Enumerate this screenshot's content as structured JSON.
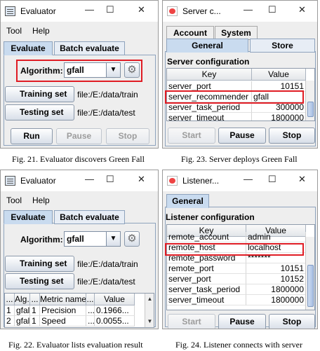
{
  "p21": {
    "title": "Evaluator",
    "menu": [
      "Tool",
      "Help"
    ],
    "tabs": [
      "Evaluate",
      "Batch evaluate"
    ],
    "algorithm_label": "Algorithm:",
    "algorithm_value": "gfall",
    "training_label": "Training set",
    "training_path": "file:/E:/data/train",
    "testing_label": "Testing set",
    "testing_path": "file:/E:/data/test",
    "run": "Run",
    "pause": "Pause",
    "stop": "Stop",
    "caption": "Fig. 21. Evaluator discovers Green Fall"
  },
  "p23": {
    "title": "Server c...",
    "tabs_top": [
      "Account",
      "System"
    ],
    "tabs_bottom": [
      "General",
      "Store"
    ],
    "section": "Server configuration",
    "col_key": "Key",
    "col_value": "Value",
    "rows": [
      {
        "key": "server_port",
        "value": "10151"
      },
      {
        "key": "server_recommender",
        "value": "gfall"
      },
      {
        "key": "server_task_period",
        "value": "300000"
      },
      {
        "key": "server_timeout",
        "value": "1800000"
      }
    ],
    "start": "Start",
    "pause": "Pause",
    "stop": "Stop",
    "caption": "Fig. 23. Server deploys Green Fall"
  },
  "p22": {
    "title": "Evaluator",
    "menu": [
      "Tool",
      "Help"
    ],
    "tabs": [
      "Evaluate",
      "Batch evaluate"
    ],
    "algorithm_label": "Algorithm:",
    "algorithm_value": "gfall",
    "training_label": "Training set",
    "training_path": "file:/E:/data/train",
    "testing_label": "Testing set",
    "testing_path": "file:/E:/data/test",
    "headers": [
      "...",
      "Alg...",
      "...",
      "Metric name",
      "...",
      "Value"
    ],
    "rows": [
      [
        "1",
        "gfall",
        "1",
        "Precision",
        "...",
        "0.1966..."
      ],
      [
        "2",
        "gfall",
        "1",
        "Speed",
        "...",
        "0.0055..."
      ]
    ],
    "caption": "Fig. 22. Evaluator lists evaluation result"
  },
  "p24": {
    "title": "Listener...",
    "tabs": [
      "General"
    ],
    "section": "Listener configuration",
    "col_key": "Key",
    "col_value": "Value",
    "rows": [
      {
        "key": "remote_account",
        "value": "admin"
      },
      {
        "key": "remote_host",
        "value": "localhost"
      },
      {
        "key": "remote_password",
        "value": "*******"
      },
      {
        "key": "remote_port",
        "value": "10151"
      },
      {
        "key": "server_port",
        "value": "10152"
      },
      {
        "key": "server_task_period",
        "value": "1800000"
      },
      {
        "key": "server_timeout",
        "value": "1800000"
      }
    ],
    "start": "Start",
    "pause": "Pause",
    "stop": "Stop",
    "caption": "Fig. 24. Listener connects with server"
  },
  "window_controls": {
    "minimize": "—",
    "maximize": "☐",
    "close": "✕"
  },
  "colors": {
    "highlight": "#e01c24",
    "selected_tab": "#c9dbef"
  }
}
